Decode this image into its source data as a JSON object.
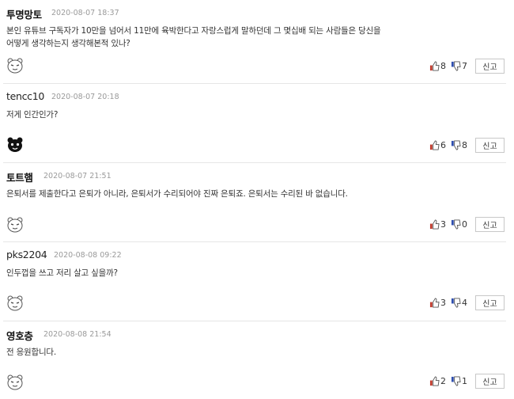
{
  "comments": [
    {
      "author": "투명망토",
      "date": "2020-08-07 18:37",
      "text": "본인 유튜브 구독자가 10만을 넘어서 11만에 육박한다고 자랑스럽게 말하던데 그 몇십배 되는 사람들은 당신을 어떻게 생각하는지 생각해본적 있나?",
      "avatar": "default-face-icon",
      "likes": "8",
      "dislikes": "7",
      "report_label": "신고"
    },
    {
      "author": "tencc10",
      "date": "2020-08-07 20:18",
      "text": "저게 인간인가?",
      "avatar": "black-bear-face-icon",
      "likes": "6",
      "dislikes": "8",
      "report_label": "신고"
    },
    {
      "author": "토트햄",
      "date": "2020-08-07 21:51",
      "text": "은퇴서를 제출한다고 은퇴가 아니라, 은퇴서가 수리되어야 진짜 은퇴죠. 은퇴서는 수리된 바 없습니다.",
      "avatar": "default-face-icon",
      "likes": "3",
      "dislikes": "0",
      "report_label": "신고"
    },
    {
      "author": "pks2204",
      "date": "2020-08-08 09:22",
      "text": "인두껍을 쓰고 저리 살고 싶을까?",
      "avatar": "default-face-icon",
      "likes": "3",
      "dislikes": "4",
      "report_label": "신고"
    },
    {
      "author": "영호층",
      "date": "2020-08-08 21:54",
      "text": "전 응원합니다.",
      "avatar": "default-face-icon",
      "likes": "2",
      "dislikes": "1",
      "report_label": "신고"
    }
  ],
  "colors": {
    "like": "#c0392b",
    "dislike": "#2f4fb0",
    "date": "#9a9a9a",
    "separator": "#e6e6e6"
  }
}
